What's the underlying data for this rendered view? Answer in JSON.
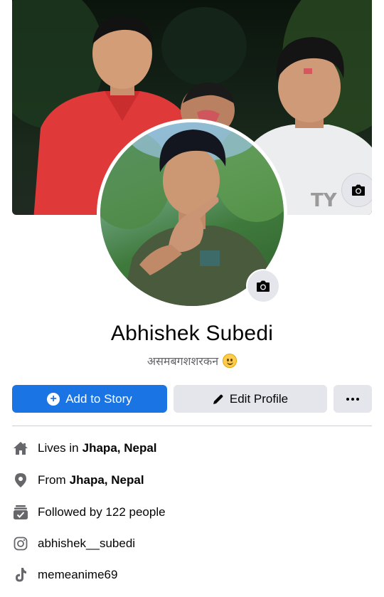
{
  "profile": {
    "name": "Abhishek Subedi",
    "bio": "असमबगशशरकन",
    "bio_emoji": "smiling-face-icon"
  },
  "actions": {
    "add_to_story": "Add to Story",
    "edit_profile": "Edit Profile",
    "more": "more-options-icon"
  },
  "details": {
    "lives_prefix": "Lives in",
    "lives_place": "Jhapa, Nepal",
    "from_prefix": "From",
    "from_place": "Jhapa, Nepal",
    "followers": "Followed by 122 people",
    "instagram": "abhishek__subedi",
    "tiktok": "memeanime69"
  },
  "colors": {
    "primary": "#1b74e4",
    "secondary_button": "#e4e6eb",
    "muted_text": "#65676b",
    "icon": "#65676b"
  }
}
